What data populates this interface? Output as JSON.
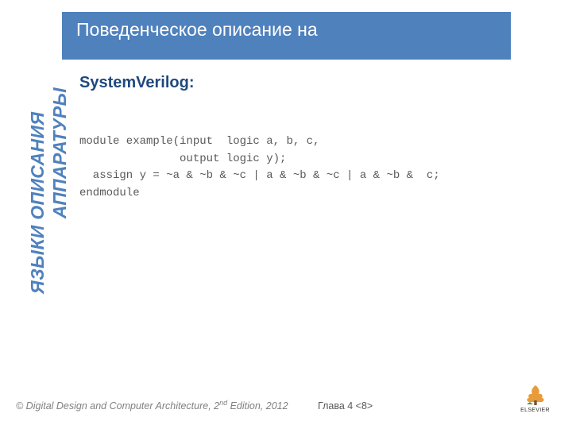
{
  "banner": {
    "title": "Поведенческое описание на"
  },
  "sidebar": {
    "line1": "ЯЗЫКИ ОПИСАНИЯ",
    "line2": "АППАРАТУРЫ"
  },
  "subtitle": "SystemVerilog:",
  "code": {
    "line1": "module example(input  logic a, b, c,",
    "line2": "               output logic y);",
    "line3": "  assign y = ~a & ~b & ~c | a & ~b & ~c | a & ~b &  c;",
    "line4": "endmodule"
  },
  "footer": {
    "copyright_prefix": "© Digital Design and Computer Architecture, 2",
    "copyright_sup": "nd",
    "copyright_suffix": " Edition, 2012",
    "chapter": "Глава 4 <8>",
    "publisher": "ELSEVIER"
  }
}
